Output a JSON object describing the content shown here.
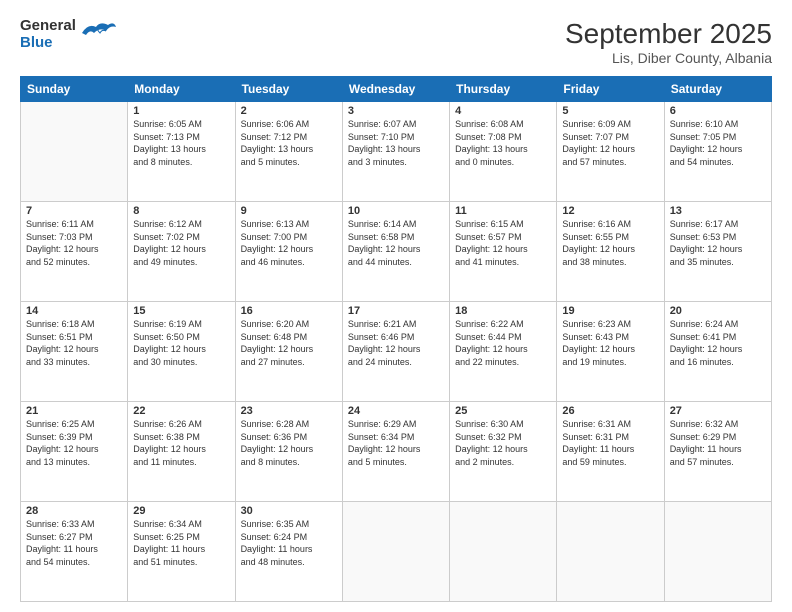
{
  "header": {
    "logo": {
      "general": "General",
      "blue": "Blue"
    },
    "title": "September 2025",
    "location": "Lis, Diber County, Albania"
  },
  "calendar": {
    "days": [
      "Sunday",
      "Monday",
      "Tuesday",
      "Wednesday",
      "Thursday",
      "Friday",
      "Saturday"
    ],
    "weeks": [
      [
        {
          "day": "",
          "info": ""
        },
        {
          "day": "1",
          "info": "Sunrise: 6:05 AM\nSunset: 7:13 PM\nDaylight: 13 hours\nand 8 minutes."
        },
        {
          "day": "2",
          "info": "Sunrise: 6:06 AM\nSunset: 7:12 PM\nDaylight: 13 hours\nand 5 minutes."
        },
        {
          "day": "3",
          "info": "Sunrise: 6:07 AM\nSunset: 7:10 PM\nDaylight: 13 hours\nand 3 minutes."
        },
        {
          "day": "4",
          "info": "Sunrise: 6:08 AM\nSunset: 7:08 PM\nDaylight: 13 hours\nand 0 minutes."
        },
        {
          "day": "5",
          "info": "Sunrise: 6:09 AM\nSunset: 7:07 PM\nDaylight: 12 hours\nand 57 minutes."
        },
        {
          "day": "6",
          "info": "Sunrise: 6:10 AM\nSunset: 7:05 PM\nDaylight: 12 hours\nand 54 minutes."
        }
      ],
      [
        {
          "day": "7",
          "info": "Sunrise: 6:11 AM\nSunset: 7:03 PM\nDaylight: 12 hours\nand 52 minutes."
        },
        {
          "day": "8",
          "info": "Sunrise: 6:12 AM\nSunset: 7:02 PM\nDaylight: 12 hours\nand 49 minutes."
        },
        {
          "day": "9",
          "info": "Sunrise: 6:13 AM\nSunset: 7:00 PM\nDaylight: 12 hours\nand 46 minutes."
        },
        {
          "day": "10",
          "info": "Sunrise: 6:14 AM\nSunset: 6:58 PM\nDaylight: 12 hours\nand 44 minutes."
        },
        {
          "day": "11",
          "info": "Sunrise: 6:15 AM\nSunset: 6:57 PM\nDaylight: 12 hours\nand 41 minutes."
        },
        {
          "day": "12",
          "info": "Sunrise: 6:16 AM\nSunset: 6:55 PM\nDaylight: 12 hours\nand 38 minutes."
        },
        {
          "day": "13",
          "info": "Sunrise: 6:17 AM\nSunset: 6:53 PM\nDaylight: 12 hours\nand 35 minutes."
        }
      ],
      [
        {
          "day": "14",
          "info": "Sunrise: 6:18 AM\nSunset: 6:51 PM\nDaylight: 12 hours\nand 33 minutes."
        },
        {
          "day": "15",
          "info": "Sunrise: 6:19 AM\nSunset: 6:50 PM\nDaylight: 12 hours\nand 30 minutes."
        },
        {
          "day": "16",
          "info": "Sunrise: 6:20 AM\nSunset: 6:48 PM\nDaylight: 12 hours\nand 27 minutes."
        },
        {
          "day": "17",
          "info": "Sunrise: 6:21 AM\nSunset: 6:46 PM\nDaylight: 12 hours\nand 24 minutes."
        },
        {
          "day": "18",
          "info": "Sunrise: 6:22 AM\nSunset: 6:44 PM\nDaylight: 12 hours\nand 22 minutes."
        },
        {
          "day": "19",
          "info": "Sunrise: 6:23 AM\nSunset: 6:43 PM\nDaylight: 12 hours\nand 19 minutes."
        },
        {
          "day": "20",
          "info": "Sunrise: 6:24 AM\nSunset: 6:41 PM\nDaylight: 12 hours\nand 16 minutes."
        }
      ],
      [
        {
          "day": "21",
          "info": "Sunrise: 6:25 AM\nSunset: 6:39 PM\nDaylight: 12 hours\nand 13 minutes."
        },
        {
          "day": "22",
          "info": "Sunrise: 6:26 AM\nSunset: 6:38 PM\nDaylight: 12 hours\nand 11 minutes."
        },
        {
          "day": "23",
          "info": "Sunrise: 6:28 AM\nSunset: 6:36 PM\nDaylight: 12 hours\nand 8 minutes."
        },
        {
          "day": "24",
          "info": "Sunrise: 6:29 AM\nSunset: 6:34 PM\nDaylight: 12 hours\nand 5 minutes."
        },
        {
          "day": "25",
          "info": "Sunrise: 6:30 AM\nSunset: 6:32 PM\nDaylight: 12 hours\nand 2 minutes."
        },
        {
          "day": "26",
          "info": "Sunrise: 6:31 AM\nSunset: 6:31 PM\nDaylight: 11 hours\nand 59 minutes."
        },
        {
          "day": "27",
          "info": "Sunrise: 6:32 AM\nSunset: 6:29 PM\nDaylight: 11 hours\nand 57 minutes."
        }
      ],
      [
        {
          "day": "28",
          "info": "Sunrise: 6:33 AM\nSunset: 6:27 PM\nDaylight: 11 hours\nand 54 minutes."
        },
        {
          "day": "29",
          "info": "Sunrise: 6:34 AM\nSunset: 6:25 PM\nDaylight: 11 hours\nand 51 minutes."
        },
        {
          "day": "30",
          "info": "Sunrise: 6:35 AM\nSunset: 6:24 PM\nDaylight: 11 hours\nand 48 minutes."
        },
        {
          "day": "",
          "info": ""
        },
        {
          "day": "",
          "info": ""
        },
        {
          "day": "",
          "info": ""
        },
        {
          "day": "",
          "info": ""
        }
      ]
    ]
  }
}
